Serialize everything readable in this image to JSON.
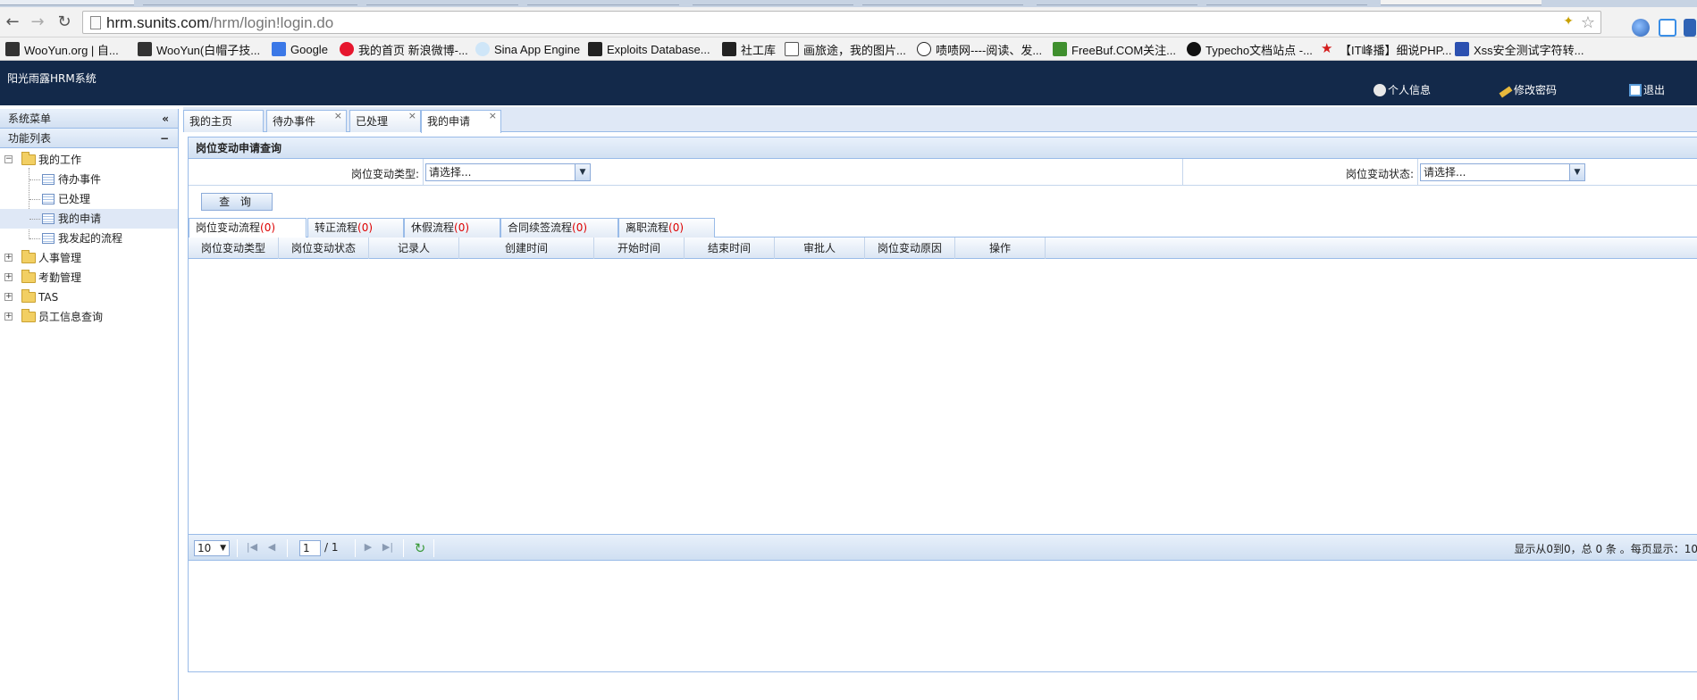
{
  "browser": {
    "url_host": "hrm.sunits.com",
    "url_path": "/hrm/login!login.do",
    "bookmarks": [
      {
        "label": "WooYun.org | 自...",
        "color": "#333333"
      },
      {
        "label": "WooYun(白帽子技...",
        "color": "#333333"
      },
      {
        "label": "Google",
        "color": "#3b78e7"
      },
      {
        "label": "我的首页 新浪微博-...",
        "color": "#e6162d"
      },
      {
        "label": "Sina App Engine",
        "color": "#6ab0e4"
      },
      {
        "label": "Exploits Database...",
        "color": "#222222"
      },
      {
        "label": "社工库",
        "color": "#222222"
      },
      {
        "label": "画旅途，我的图片...",
        "color": "#555555"
      },
      {
        "label": "啧啧网----阅读、发...",
        "color": "#222222"
      },
      {
        "label": "FreeBuf.COM关注...",
        "color": "#3f8f2e"
      },
      {
        "label": "Typecho文档站点 -...",
        "color": "#111111"
      },
      {
        "label": "【IT峰播】细说PHP...",
        "color": "#d41d1d"
      },
      {
        "label": "Xss安全测试字符转...",
        "color": "#2b50b0"
      }
    ]
  },
  "header": {
    "title": "阳光雨露HRM系统",
    "links": {
      "profile": "个人信息",
      "password": "修改密码",
      "logout": "退出"
    }
  },
  "sidebar": {
    "menu_title": "系统菜单",
    "menu_collapse": "«",
    "list_title": "功能列表",
    "list_collapse": "−",
    "tree": {
      "my_work": "我的工作",
      "items": [
        "待办事件",
        "已处理",
        "我的申请",
        "我发起的流程"
      ],
      "hr": "人事管理",
      "attendance": "考勤管理",
      "tas": "TAS",
      "employee": "员工信息查询"
    }
  },
  "tabs": [
    {
      "label": "我的主页"
    },
    {
      "label": "待办事件",
      "close": "×"
    },
    {
      "label": "已处理",
      "close": "×"
    },
    {
      "label": "我的申请",
      "close": "×"
    }
  ],
  "query": {
    "title": "岗位变动申请查询",
    "type_label": "岗位变动类型:",
    "type_value": "请选择...",
    "status_label": "岗位变动状态:",
    "status_value": "请选择...",
    "button": "查 询"
  },
  "subtabs": [
    {
      "label": "岗位变动流程",
      "count": "(0)"
    },
    {
      "label": "转正流程",
      "count": "(0)"
    },
    {
      "label": "休假流程",
      "count": "(0)"
    },
    {
      "label": "合同续签流程",
      "count": "(0)"
    },
    {
      "label": "离职流程",
      "count": "(0)"
    }
  ],
  "columns": [
    "岗位变动类型",
    "岗位变动状态",
    "记录人",
    "创建时间",
    "开始时间",
    "结束时间",
    "审批人",
    "岗位变动原因",
    "操作"
  ],
  "pager": {
    "page_size": "10",
    "page": "1",
    "total": "/ 1",
    "info": "显示从0到0，总 0 条 。每页显示：10"
  }
}
